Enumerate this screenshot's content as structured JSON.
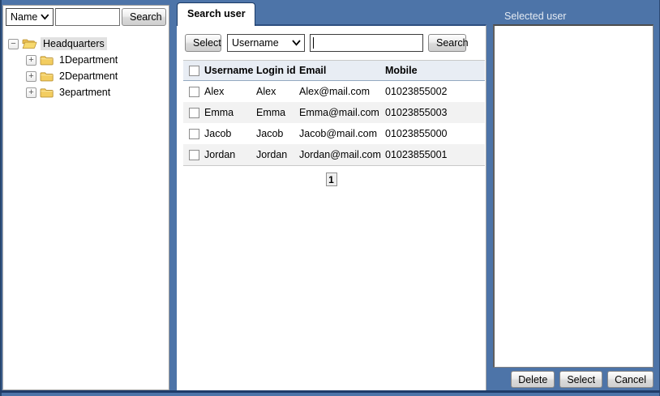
{
  "window": {
    "background_color": "#4d74a8",
    "frame_color": "#1f3c69"
  },
  "icons": {
    "tree_collapse": "−",
    "tree_expand": "+",
    "dropdown_chevron": "chevron-down",
    "open_folder": "open-folder",
    "closed_folder": "folder"
  },
  "org_panel": {
    "filter": {
      "field_selected": "Name",
      "search_value": "",
      "search_button": "Search"
    },
    "tree": {
      "root": {
        "label": "Headquarters",
        "state": "expanded",
        "selected": true
      },
      "children": [
        {
          "label": "1Department",
          "state": "collapsed"
        },
        {
          "label": "2Department",
          "state": "collapsed"
        },
        {
          "label": "3epartment",
          "state": "collapsed"
        }
      ]
    }
  },
  "search_panel": {
    "tab_label": "Search user",
    "toolbar": {
      "select_button": "Select",
      "field_selected": "Username",
      "search_value": "",
      "search_button": "Search"
    },
    "table": {
      "columns": [
        "Username",
        "Login id",
        "Email",
        "Mobile"
      ],
      "rows": [
        {
          "checked": false,
          "username": "Alex",
          "login_id": "Alex",
          "email": "Alex@mail.com",
          "mobile": "01023855002"
        },
        {
          "checked": false,
          "username": "Emma",
          "login_id": "Emma",
          "email": "Emma@mail.com",
          "mobile": "01023855003"
        },
        {
          "checked": false,
          "username": "Jacob",
          "login_id": "Jacob",
          "email": "Jacob@mail.com",
          "mobile": "01023855000"
        },
        {
          "checked": false,
          "username": "Jordan",
          "login_id": "Jordan",
          "email": "Jordan@mail.com",
          "mobile": "01023855001"
        }
      ],
      "pagination": {
        "current_page": "1"
      }
    }
  },
  "selected_panel": {
    "title": "Selected user",
    "items": [],
    "buttons": {
      "delete": "Delete",
      "select": "Select",
      "cancel": "Cancel"
    }
  }
}
